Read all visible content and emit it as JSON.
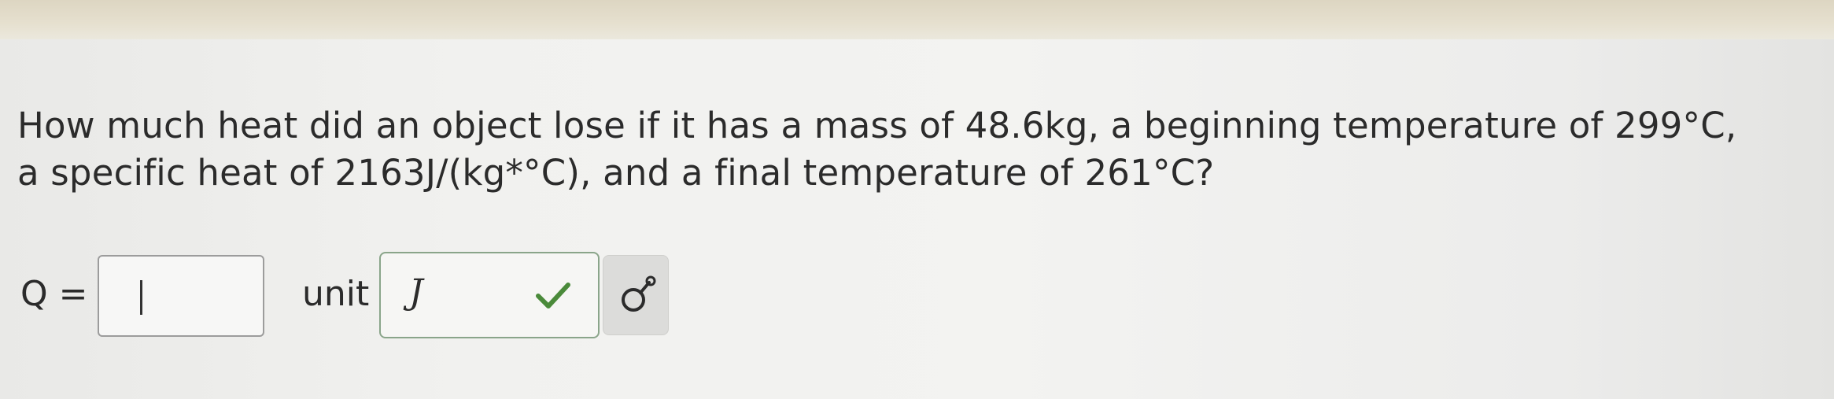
{
  "question": {
    "line1": "How much heat did an object lose if it has a mass of 48.6kg, a beginning temperature of 299°C,",
    "line2": "a specific heat of 2163J/(kg*°C), and a final temperature of 261°C?"
  },
  "answer": {
    "q_label": "Q =",
    "q_value": "",
    "unit_label": "unit",
    "unit_value": "J"
  },
  "icons": {
    "unit_status": "check-icon",
    "tool_button": "units-picker-icon"
  },
  "colors": {
    "check": "#4a8a3a"
  }
}
